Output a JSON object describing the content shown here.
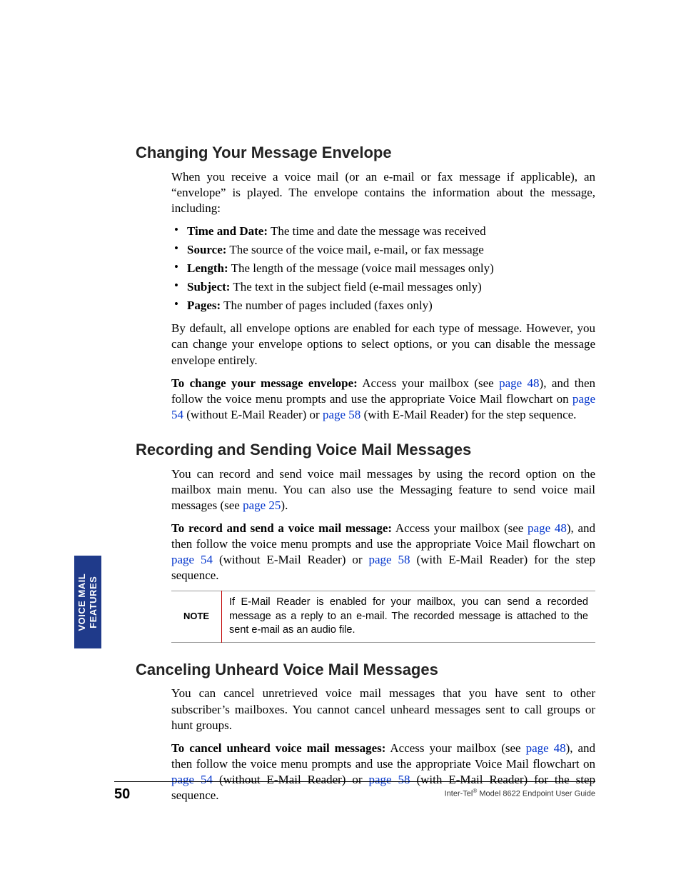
{
  "side_tab": {
    "line1": "VOICE MAIL",
    "line2": "FEATURES"
  },
  "sections": {
    "s1": {
      "heading": "Changing Your Message Envelope",
      "intro": "When you receive a voice mail (or an e-mail or fax message if applicable), an “envelope” is played. The envelope contains the information about the message, including:",
      "bullets": [
        {
          "term": "Time and Date:",
          "desc": " The time and date the message was received"
        },
        {
          "term": "Source:",
          "desc": " The source of the voice mail, e-mail, or fax message"
        },
        {
          "term": "Length:",
          "desc": " The length of the message (voice mail messages only)"
        },
        {
          "term": "Subject:",
          "desc": " The text in the subject field (e-mail messages only)"
        },
        {
          "term": "Pages:",
          "desc": " The number of pages included (faxes only)"
        }
      ],
      "p_default": "By default, all envelope options are enabled for each type of message. However, you can change your envelope options to select options, or you can disable the message envelope entirely.",
      "howto_lead": "To change your message envelope:",
      "howto_frag1": " Access your mailbox (see ",
      "link48": "page 48",
      "howto_frag2": "), and then follow the voice menu prompts and use the appropriate Voice Mail flowchart on ",
      "link54": "page 54",
      "howto_frag3": " (without E-Mail Reader) or ",
      "link58": "page 58",
      "howto_frag4": " (with E-Mail Reader) for the step sequence."
    },
    "s2": {
      "heading": "Recording and Sending Voice Mail Messages",
      "intro_frag1": "You can record and send voice mail messages by using the record option on the mailbox main menu. You can also use the Messaging feature to send voice mail messages (see ",
      "link25": "page 25",
      "intro_frag2": ").",
      "howto_lead": "To record and send a voice mail message:",
      "howto_frag1": " Access your mailbox (see ",
      "link48": "page 48",
      "howto_frag2": "), and then follow the voice menu prompts and use the appropriate Voice Mail flowchart on ",
      "link54": "page 54",
      "howto_frag3": " (without E-Mail Reader) or ",
      "link58": "page 58",
      "howto_frag4": " (with E-Mail Reader) for the step sequence.",
      "note_label": "NOTE",
      "note_text": "If E-Mail Reader is enabled for your mailbox, you can send a recorded message as a reply to an e-mail. The recorded message is attached to the sent e-mail as an audio file."
    },
    "s3": {
      "heading": "Canceling Unheard Voice Mail Messages",
      "intro": "You can cancel unretrieved voice mail messages that you have sent to other subscriber’s mailboxes. You cannot cancel unheard messages sent to call groups or hunt groups.",
      "howto_lead": "To cancel unheard voice mail messages:",
      "howto_frag1": " Access your mailbox (see ",
      "link48": "page 48",
      "howto_frag2": "), and then follow the voice menu prompts and use the appropriate Voice Mail flowchart on ",
      "link54": "page 54",
      "howto_frag3": " (without E-Mail Reader) or ",
      "link58": "page 58",
      "howto_frag4": " (with E-Mail Reader) for the step sequence."
    }
  },
  "footer": {
    "page_number": "50",
    "brand": "Inter-Tel",
    "rest": " Model 8622 Endpoint User Guide"
  }
}
